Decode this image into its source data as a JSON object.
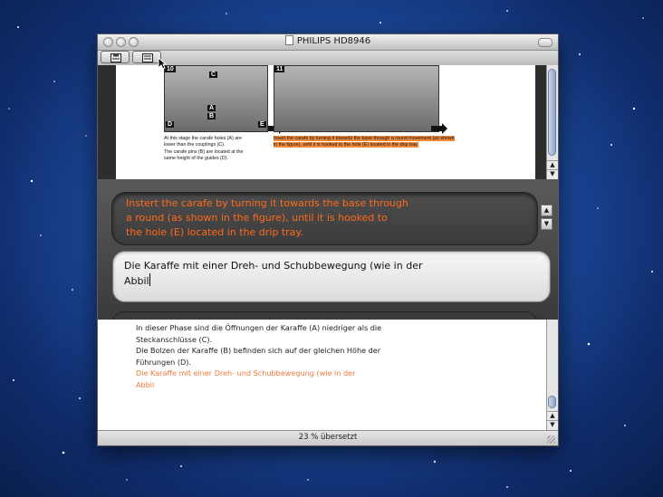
{
  "window": {
    "title": "PHILIPS HD8946"
  },
  "toolbar": {
    "buttons": [
      {
        "icon": "save-icon"
      },
      {
        "icon": "export-icon"
      }
    ]
  },
  "document": {
    "fig10": {
      "number": "10",
      "callouts": [
        "C",
        "A",
        "B",
        "D",
        "E"
      ]
    },
    "fig11": {
      "number": "11"
    },
    "caption_left": [
      "At this stage the carafe holes (A) are",
      "lower than the couplings (C).",
      "The carafe pins (B) are located at the",
      "same height of the guides (D)."
    ],
    "caption_right": [
      "Insert the carafe by turning it towards the base through a round movement (as shown",
      "in the figure), until it is hooked to the hole (E) located in the drip tray."
    ]
  },
  "source": {
    "lines": [
      "Instert the carafe by turning it towards the base through",
      "a round (as shown in the figure), until it is hooked to",
      "the hole (E) located in the drip tray."
    ],
    "color": "#ff6a1a"
  },
  "target": {
    "lines": [
      "Die Karaffe mit einer Dreh- und Schubbewegung (wie in der",
      "Abbil"
    ]
  },
  "output": {
    "translated": [
      "In dieser Phase sind die Öffnungen der Karaffe (A) niedriger als die",
      "Steckanschlüsse (C).",
      "Die Bolzen der Karaffe (B) befinden sich auf der gleichen Höhe der",
      "Führungen (D)."
    ],
    "current": [
      "Die Karaffe mit einer Dreh- und Schubbewegung (wie in der",
      "Abbil"
    ],
    "current_color": "#f07a3a"
  },
  "status": {
    "text": "23 % übersetzt",
    "progress_percent": 23
  }
}
